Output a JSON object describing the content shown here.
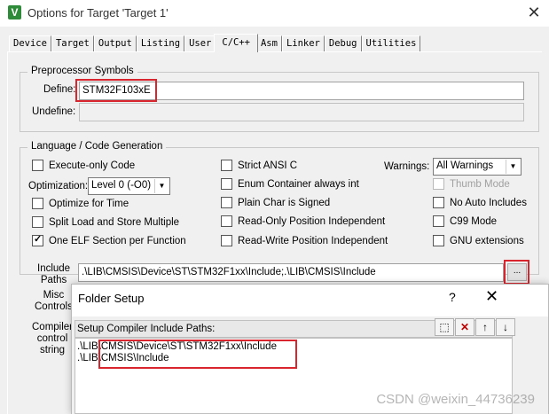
{
  "window": {
    "title": "Options for Target 'Target 1'",
    "icon_letter": "V",
    "close_glyph": "✕"
  },
  "tabs": [
    {
      "label": "Device"
    },
    {
      "label": "Target"
    },
    {
      "label": "Output"
    },
    {
      "label": "Listing"
    },
    {
      "label": "User"
    },
    {
      "label": "C/C++"
    },
    {
      "label": "Asm"
    },
    {
      "label": "Linker"
    },
    {
      "label": "Debug"
    },
    {
      "label": "Utilities"
    }
  ],
  "active_tab": "C/C++",
  "preprocessor": {
    "title": "Preprocessor Symbols",
    "define_label": "Define:",
    "define_value": "STM32F103xE",
    "undefine_label": "Undefine:",
    "undefine_value": ""
  },
  "language": {
    "title": "Language / Code Generation",
    "execute_only": {
      "label": "Execute-only Code",
      "checked": false
    },
    "optimization_label": "Optimization:",
    "optimization_value": "Level 0 (-O0)",
    "optimize_time": {
      "label": "Optimize for Time",
      "checked": false
    },
    "split_load": {
      "label": "Split Load and Store Multiple",
      "checked": false
    },
    "one_elf": {
      "label": "One ELF Section per Function",
      "checked": true
    },
    "strict_ansi": {
      "label": "Strict ANSI C",
      "checked": false
    },
    "enum_container": {
      "label": "Enum Container always int",
      "checked": false
    },
    "plain_char": {
      "label": "Plain Char is Signed",
      "checked": false
    },
    "ro_pi": {
      "label": "Read-Only Position Independent",
      "checked": false
    },
    "rw_pi": {
      "label": "Read-Write Position Independent",
      "checked": false
    },
    "warnings_label": "Warnings:",
    "warnings_value": "All Warnings",
    "thumb_mode": {
      "label": "Thumb Mode",
      "checked": false,
      "disabled": true
    },
    "no_auto_includes": {
      "label": "No Auto Includes",
      "checked": false
    },
    "c99_mode": {
      "label": "C99 Mode",
      "checked": false
    },
    "gnu_ext": {
      "label": "GNU extensions",
      "checked": false
    }
  },
  "include": {
    "label_line1": "Include",
    "label_line2": "Paths",
    "value": ".\\LIB\\CMSIS\\Device\\ST\\STM32F1xx\\Include;.\\LIB\\CMSIS\\Include",
    "browse_label": "...",
    "misc_line1": "Misc",
    "misc_line2": "Controls",
    "compiler_line1": "Compiler",
    "compiler_line2": "control",
    "compiler_line3": "string"
  },
  "folder_setup": {
    "title": "Folder Setup",
    "help_glyph": "?",
    "close_glyph": "✕",
    "list_header": "Setup Compiler Include Paths:",
    "paths": [
      ".\\LIB\\CMSIS\\Device\\ST\\STM32F1xx\\Include",
      ".\\LIB\\CMSIS\\Include"
    ],
    "tool_new": "⬚",
    "tool_delete": "✕",
    "tool_up": "↑",
    "tool_down": "↓"
  },
  "watermark": "CSDN @weixin_44736239",
  "colors": {
    "highlight_red": "#d9252e",
    "delete_red": "#c00000"
  }
}
